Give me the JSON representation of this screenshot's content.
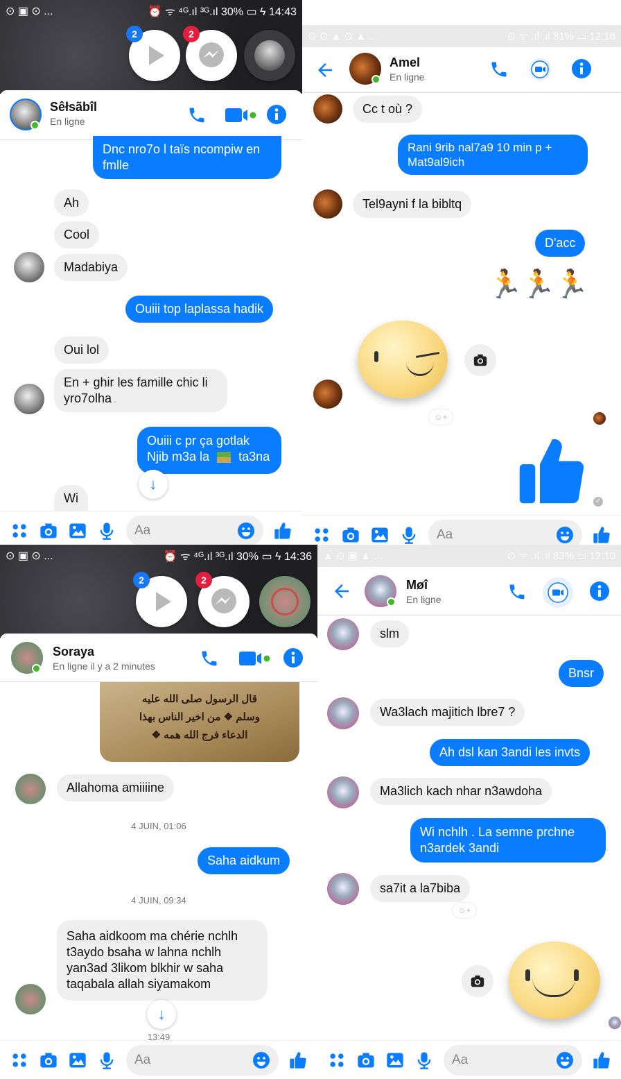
{
  "colors": {
    "accent": "#0a7cff",
    "bubble_in": "#efefef",
    "online": "#42b72a",
    "badge": "#e41e3f",
    "badge_blue": "#1877f2"
  },
  "p1": {
    "status": {
      "left": "⊙ ▣ ⊙ ...",
      "right": "⏰ ᯤ ⁴ᴳ.ıl ³ᴳ.ıl 30% ▭ ϟ 14:43"
    },
    "chatheads": [
      {
        "badge": "2",
        "icon": "play-icon"
      },
      {
        "badge": "2",
        "icon": "messenger-icon"
      }
    ],
    "header": {
      "name": "Sêłsãbîl",
      "status": "En ligne"
    },
    "messages": [
      "Dnc nro7o l taïs ncompiw en fmlle",
      "Ah",
      "Cool",
      "Madabiya",
      "Ouiii top laplassa hadik",
      "Oui lol",
      "En + ghir les famille chic li yro7olha",
      "Ouiii c pr ça gotlak Njib m3a la",
      "ta3na",
      "Wi"
    ],
    "input_placeholder": "Aa"
  },
  "p2": {
    "status": {
      "left": "⊙ ⊙ ▲ ⊙ ▲ ...",
      "right": "⊙ ᯤ .ıl .ıl 81% ▭ 12:18"
    },
    "header": {
      "name": "Amel",
      "status": "En ligne"
    },
    "messages": [
      "Cc t où ?",
      "Rani 9rib nal7a9 10 min  p + Mat9al9ich",
      "Tel9ayni f la bibltq",
      "D'acc",
      "🏃🏃🏃"
    ],
    "input_placeholder": "Aa"
  },
  "p3": {
    "status": {
      "left": "⊙ ▣ ⊙ ...",
      "right": "⏰ ᯤ ⁴ᴳ.ıl ³ᴳ.ıl 30% ▭ ϟ 14:36"
    },
    "chatheads": [
      {
        "badge": "2",
        "icon": "play-icon"
      },
      {
        "badge": "2",
        "icon": "messenger-icon"
      }
    ],
    "header": {
      "name": "Soraya",
      "status": "En ligne il y a 2 minutes"
    },
    "arabic": [
      "قال الرسول صلى الله عليه",
      "وسلم ❖ من اخير الناس بهذا",
      "الدعاء فرج الله همه ❖"
    ],
    "messages": [
      "Allahoma amiiiine",
      "Saha aidkum",
      "Saha aidkoom ma chérie nchlh t3aydo bsaha w lahna nchlh yan3ad 3likom blkhir w saha taqabala allah siyamakom"
    ],
    "timestamps": [
      "4 JUIN, 01:06",
      "4 JUIN, 09:34",
      "13:49"
    ],
    "input_placeholder": "Aa"
  },
  "p4": {
    "status": {
      "left": "▲ ⊙ ▣ ▲ ...",
      "right": "⊙ ᯤ .ıl .ıl 83% ▭ 12:10"
    },
    "header": {
      "name": "Møî",
      "status": "En ligne"
    },
    "messages": [
      "slm",
      "Bnsr",
      "Wa3lach majitich lbre7 ?",
      "Ah dsl kan 3andi les invts",
      "Ma3lich kach nhar n3awdoha",
      "Wi nchlh . La semne prchne n3ardek 3andi",
      "sa7it a la7biba"
    ],
    "input_placeholder": "Aa"
  }
}
